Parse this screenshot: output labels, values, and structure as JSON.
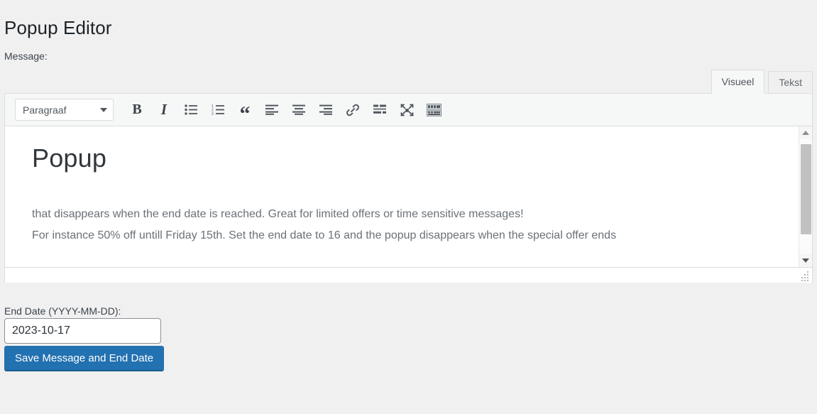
{
  "page": {
    "title": "Popup Editor",
    "message_label": "Message:",
    "end_date_label": "End Date (YYYY-MM-DD):"
  },
  "editor": {
    "tabs": [
      {
        "label": "Visueel",
        "active": true
      },
      {
        "label": "Tekst",
        "active": false
      }
    ],
    "toolbar": {
      "format_select": {
        "value": "Paragraaf",
        "caret_icon": "chevron-down-icon"
      },
      "buttons": [
        {
          "name": "bold-icon",
          "label": "B"
        },
        {
          "name": "italic-icon",
          "label": "I"
        },
        {
          "name": "bulleted-list-icon",
          "label": ""
        },
        {
          "name": "numbered-list-icon",
          "label": ""
        },
        {
          "name": "blockquote-icon",
          "label": "“"
        },
        {
          "name": "align-left-icon",
          "label": ""
        },
        {
          "name": "align-center-icon",
          "label": ""
        },
        {
          "name": "align-right-icon",
          "label": ""
        },
        {
          "name": "link-icon",
          "label": ""
        },
        {
          "name": "read-more-icon",
          "label": ""
        },
        {
          "name": "fullscreen-icon",
          "label": ""
        },
        {
          "name": "toolbar-toggle-icon",
          "label": ""
        }
      ]
    },
    "content": {
      "heading": "Popup",
      "paragraph_1": "that disappears when the end date is reached. Great for limited offers or time sensitive messages!",
      "paragraph_2": "For instance 50% off untill Friday 15th. Set the end date to 16 and the popup disappears when the special offer ends"
    },
    "scrollbar": {
      "up_icon": "scroll-up-arrow-icon",
      "down_icon": "scroll-down-arrow-icon"
    },
    "resize_handle_icon": "resize-grip-icon"
  },
  "form": {
    "end_date_value": "2023-10-17",
    "end_date_placeholder": "YYYY-MM-DD",
    "save_button_label": "Save Message and End Date"
  },
  "colors": {
    "background": "#f0f0f1",
    "primary_button": "#2271b1",
    "border": "#dcdcde",
    "text": "#3c434a"
  }
}
